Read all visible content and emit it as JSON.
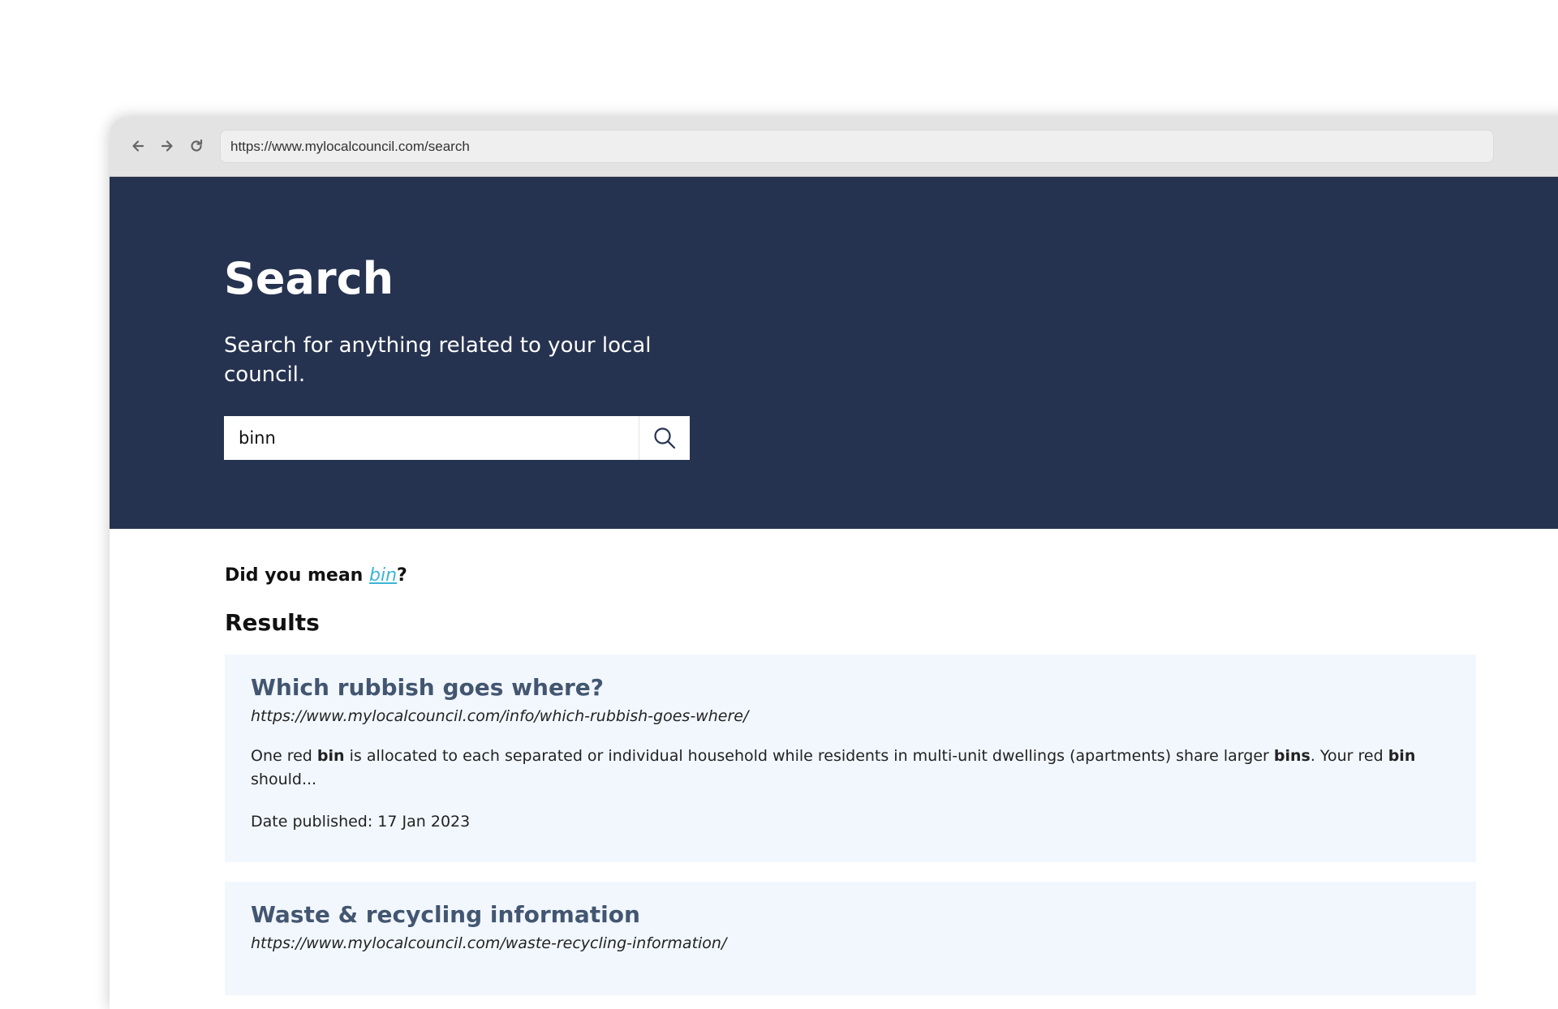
{
  "browser": {
    "url": "https://www.mylocalcouncil.com/search"
  },
  "hero": {
    "title": "Search",
    "subtitle": "Search for anything related to your local council.",
    "search_value": "binn"
  },
  "suggestion": {
    "prefix": "Did you mean ",
    "term": "bin",
    "suffix": "?"
  },
  "results": {
    "heading": "Results",
    "items": [
      {
        "title": "Which rubbish goes where?",
        "url": "https://www.mylocalcouncil.com/info/which-rubbish-goes-where/",
        "snippet": {
          "t1": "One red ",
          "b1": "bin",
          "t2": " is allocated to each separated or individual household while residents in multi-unit dwellings (apartments) share larger ",
          "b2": "bins",
          "t3": ". Your red ",
          "b3": "bin",
          "t4": " should..."
        },
        "date": "Date published: 17 Jan 2023"
      },
      {
        "title": "Waste & recycling information",
        "url": "https://www.mylocalcouncil.com/waste-recycling-information/"
      }
    ]
  },
  "colors": {
    "hero_bg": "#263350",
    "card_bg": "#f2f7fd",
    "result_title": "#435671",
    "link_accent": "#3bb4d8"
  }
}
